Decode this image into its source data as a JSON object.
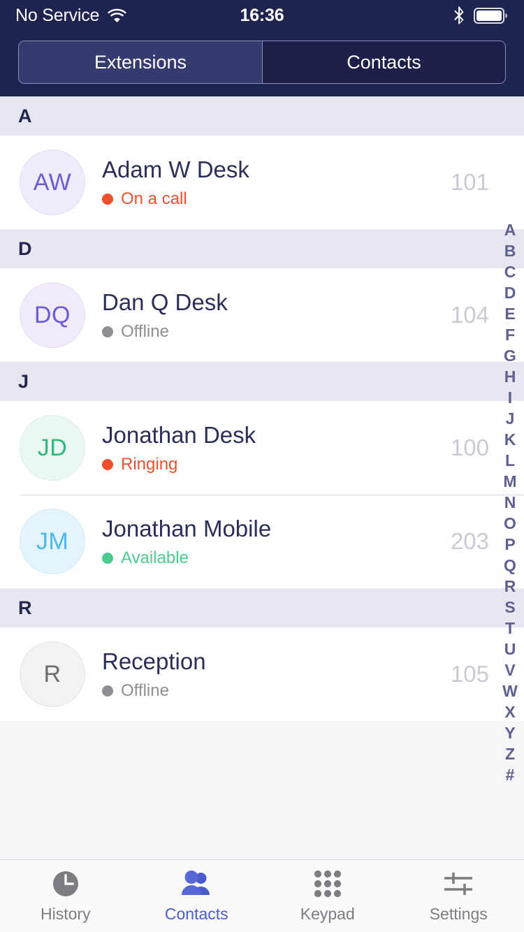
{
  "status_bar": {
    "carrier": "No Service",
    "time": "16:36",
    "wifi_icon": "wifi-icon",
    "bluetooth_icon": "bluetooth-icon",
    "battery_icon": "battery-full-icon"
  },
  "segmented_control": {
    "selected": "Extensions",
    "options": [
      {
        "label": "Extensions",
        "active": true
      },
      {
        "label": "Contacts",
        "active": false
      }
    ]
  },
  "colors": {
    "header_bg": "#1E2350",
    "segment_active_bg": "#353B6E",
    "section_header_bg": "#E6E7F1",
    "name_text": "#2B2F58",
    "extension_text": "#C9CBD4",
    "status_on_call": "#F0502E",
    "status_ringing": "#F0502E",
    "status_available": "#4BCC8E",
    "status_offline": "#8E8E93",
    "tab_active": "#4A5BD0",
    "tab_inactive": "#7C7C82",
    "page_bg": "#F5F6F8"
  },
  "sections": [
    {
      "letter": "A",
      "contacts": [
        {
          "initials": "AW",
          "name": "Adam W Desk",
          "status": "On a call",
          "status_kind": "on-call",
          "extension": "101",
          "avatar_bg": "#EFEBFA",
          "avatar_fg": "#6B5BD6",
          "avatar_border": "#E2DCF4"
        }
      ]
    },
    {
      "letter": "D",
      "contacts": [
        {
          "initials": "DQ",
          "name": "Dan Q Desk",
          "status": "Offline",
          "status_kind": "offline",
          "extension": "104",
          "avatar_bg": "#F0EAF9",
          "avatar_fg": "#6B5BD6",
          "avatar_border": "#E4DCF2"
        }
      ]
    },
    {
      "letter": "J",
      "contacts": [
        {
          "initials": "JD",
          "name": "Jonathan Desk",
          "status": "Ringing",
          "status_kind": "ringing",
          "extension": "100",
          "avatar_bg": "#EAF8F1",
          "avatar_fg": "#2FB87E",
          "avatar_border": "#DCEFE5"
        },
        {
          "initials": "JM",
          "name": "Jonathan Mobile",
          "status": "Available",
          "status_kind": "available",
          "extension": "203",
          "avatar_bg": "#E3F4FD",
          "avatar_fg": "#4BB8E8",
          "avatar_border": "#D4E9F5"
        }
      ]
    },
    {
      "letter": "R",
      "contacts": [
        {
          "initials": "R",
          "name": "Reception",
          "status": "Offline",
          "status_kind": "offline",
          "extension": "105",
          "avatar_bg": "#F2F2F3",
          "avatar_fg": "#6D6D72",
          "avatar_border": "#E4E4E6"
        }
      ]
    }
  ],
  "alpha_index": [
    "A",
    "B",
    "C",
    "D",
    "E",
    "F",
    "G",
    "H",
    "I",
    "J",
    "K",
    "L",
    "M",
    "N",
    "O",
    "P",
    "Q",
    "R",
    "S",
    "T",
    "U",
    "V",
    "W",
    "X",
    "Y",
    "Z",
    "#"
  ],
  "tab_bar": {
    "tabs": [
      {
        "label": "History",
        "icon": "clock-icon",
        "active": false
      },
      {
        "label": "Contacts",
        "icon": "people-icon",
        "active": true
      },
      {
        "label": "Keypad",
        "icon": "dialpad-icon",
        "active": false
      },
      {
        "label": "Settings",
        "icon": "sliders-icon",
        "active": false
      }
    ]
  }
}
